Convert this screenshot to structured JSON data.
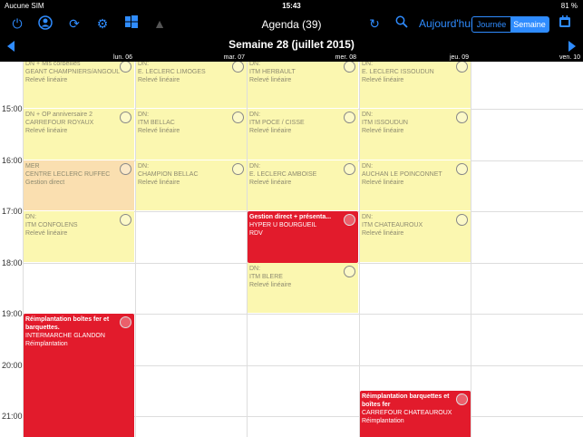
{
  "status": {
    "carrier": "Aucune SIM",
    "time": "15:43",
    "battery": "81 %"
  },
  "toolbar": {
    "title": "Agenda (39)",
    "today": "Aujourd'hui",
    "day_view": "Journée",
    "week_view": "Semaine",
    "icons": [
      "power-icon",
      "user-icon",
      "sync-icon",
      "gear-icon",
      "windows-icon",
      "warning-icon",
      "refresh-icon",
      "search-icon",
      "calendar-icon"
    ]
  },
  "week": {
    "title": "Semaine 28 (juillet 2015)"
  },
  "days": [
    "lun. 06",
    "mar. 07",
    "mer. 08",
    "jeu. 09",
    "ven. 10"
  ],
  "hours": [
    "15:00",
    "16:00",
    "17:00",
    "18:00",
    "19:00",
    "20:00",
    "21:00"
  ],
  "events": [
    {
      "day": 0,
      "start": 14.0,
      "end": 15.0,
      "color": "yellow",
      "l1": "DN + Mls corbeilles",
      "l2": "GEANT CHAMPNIERS/ANGOUL",
      "l3": "Relevé linéaire"
    },
    {
      "day": 1,
      "start": 14.0,
      "end": 15.0,
      "color": "yellow",
      "l1": "DN:",
      "l2": "E. LECLERC LIMOGES",
      "l3": "Relevé linéaire"
    },
    {
      "day": 2,
      "start": 14.0,
      "end": 15.0,
      "color": "yellow",
      "l1": "DN:",
      "l2": "ITM HERBAULT",
      "l3": "Relevé linéaire"
    },
    {
      "day": 3,
      "start": 14.0,
      "end": 15.0,
      "color": "yellow",
      "l1": "DN:",
      "l2": "E. LECLERC ISSOUDUN",
      "l3": "Relevé linéaire"
    },
    {
      "day": 0,
      "start": 15.0,
      "end": 16.0,
      "color": "yellow",
      "l1": "DN + OP anniversaire 2",
      "l2": "CARREFOUR ROYAUX",
      "l3": "Relevé linéaire"
    },
    {
      "day": 1,
      "start": 15.0,
      "end": 16.0,
      "color": "yellow",
      "l1": "DN:",
      "l2": "ITM BELLAC",
      "l3": "Relevé linéaire"
    },
    {
      "day": 2,
      "start": 15.0,
      "end": 16.0,
      "color": "yellow",
      "l1": "DN:",
      "l2": "ITM POCE / CISSE",
      "l3": "Relevé linéaire"
    },
    {
      "day": 3,
      "start": 15.0,
      "end": 16.0,
      "color": "yellow",
      "l1": "DN:",
      "l2": "ITM ISSOUDUN",
      "l3": "Relevé linéaire"
    },
    {
      "day": 0,
      "start": 16.0,
      "end": 17.0,
      "color": "orange",
      "l1": "MER",
      "l2": "CENTRE LECLERC RUFFEC",
      "l3": "Gestion direct"
    },
    {
      "day": 1,
      "start": 16.0,
      "end": 17.0,
      "color": "yellow",
      "l1": "DN:",
      "l2": "CHAMPION BELLAC",
      "l3": "Relevé linéaire"
    },
    {
      "day": 2,
      "start": 16.0,
      "end": 17.0,
      "color": "yellow",
      "l1": "DN:",
      "l2": "E. LECLERC AMBOISE",
      "l3": "Relevé linéaire"
    },
    {
      "day": 3,
      "start": 16.0,
      "end": 17.0,
      "color": "yellow",
      "l1": "DN:",
      "l2": "AUCHAN LE POINCONNET",
      "l3": "Relevé linéaire"
    },
    {
      "day": 0,
      "start": 17.0,
      "end": 18.0,
      "color": "yellow",
      "l1": "DN:",
      "l2": "ITM CONFOLENS",
      "l3": "Relevé linéaire"
    },
    {
      "day": 2,
      "start": 17.0,
      "end": 18.0,
      "color": "red",
      "l1": "Gestion direct + présenta...",
      "l2": "HYPER U BOURGUEIL",
      "l3": "RDV"
    },
    {
      "day": 3,
      "start": 17.0,
      "end": 18.0,
      "color": "yellow",
      "l1": "DN:",
      "l2": "ITM CHATEAUROUX",
      "l3": "Relevé linéaire"
    },
    {
      "day": 2,
      "start": 18.0,
      "end": 19.0,
      "color": "yellow",
      "l1": "DN:",
      "l2": "ITM BLERE",
      "l3": "Relevé linéaire"
    },
    {
      "day": 0,
      "start": 19.0,
      "end": 21.5,
      "color": "red",
      "l1": "Réimplantation boîtes fer et barquettes.",
      "l2": "INTERMARCHE GLANDON",
      "l3": "Réimplantation"
    },
    {
      "day": 3,
      "start": 20.5,
      "end": 21.5,
      "color": "red",
      "l1": "Réimplantation barquettes et boîtes fer",
      "l2": "CARREFOUR CHATEAUROUX",
      "l3": "Réimplantation"
    }
  ]
}
